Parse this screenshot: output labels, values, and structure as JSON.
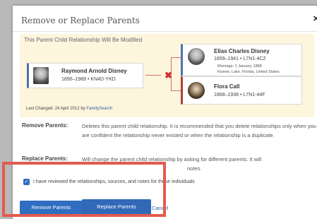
{
  "dialog": {
    "title": "Remove or Replace Parents",
    "close_glyph": "×",
    "close_icon": "close-icon"
  },
  "panel": {
    "heading": "This Parent Child Relationship Will Be Modified",
    "child": {
      "name": "Raymond Arnold Disney",
      "lifespan": "1890–1989",
      "id": "KN4D-YKD"
    },
    "father": {
      "name": "Elias Charles Disney",
      "lifespan": "1859–1941",
      "id": "L7N1-4CZ",
      "marriage": "Marriage: 1 January 1888",
      "place": "Kismet, Lake, Florida, United States"
    },
    "mother": {
      "name": "Flora Call",
      "lifespan": "1868–1938",
      "id": "L7N1-44F"
    },
    "separator": "•",
    "relationship_glyph": "✖",
    "relationship_icon": "remove-relationship-icon",
    "last_changed_label": "Last Changed: 24 April 2012 by",
    "last_changed_by": "FamilySearch"
  },
  "descriptions": {
    "remove_label": "Remove Parents:",
    "remove_text": "Deletes this parent child relationship. It is recommended that you delete relationships only when you are confident the relationship never existed or when the relationship is a duplicate.",
    "replace_label": "Replace Parents:",
    "replace_text": "Will change the parent child relationship by asking for different parents. It will",
    "replace_text_cont": "notes."
  },
  "confirm": {
    "checked": true,
    "check_glyph": "✓",
    "text": "I have reviewed the relationships, sources, and notes for these individuals"
  },
  "buttons": {
    "remove": "Remove Parents",
    "replace": "Replace Parents",
    "cancel": "Cancel"
  },
  "colors": {
    "accent": "#2f6ec0",
    "panel_bg": "#fdf5dc",
    "highlight": "#e35a4f",
    "male": "#4a74b4",
    "female": "#b0403c"
  }
}
